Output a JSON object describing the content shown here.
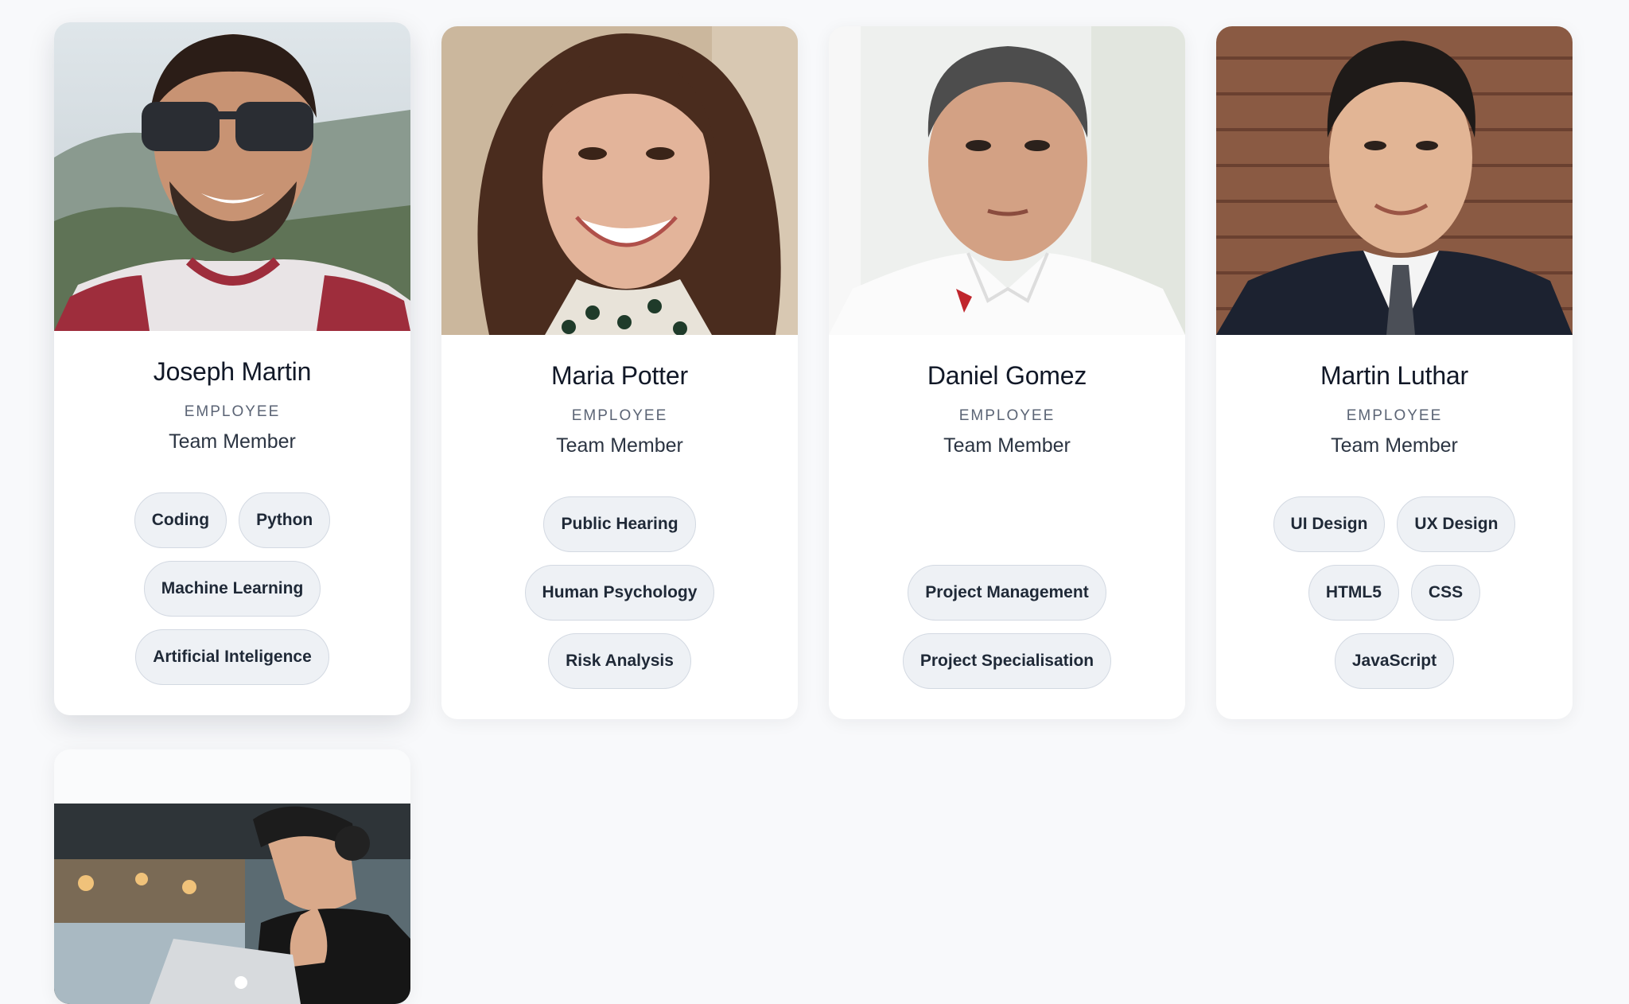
{
  "cards": [
    {
      "name": "Joseph Martin",
      "role": "EMPLOYEE",
      "title": "Team Member",
      "photo": "portrait-man-sunglasses",
      "tag_rows": [
        [
          "Coding",
          "Python"
        ],
        [
          "Machine Learning"
        ],
        [
          "Artificial Inteligence"
        ]
      ]
    },
    {
      "name": "Maria Potter",
      "role": "EMPLOYEE",
      "title": "Team Member",
      "photo": "portrait-woman-smiling",
      "tag_rows": [
        [
          "Public Hearing"
        ],
        [
          "Human Psychology"
        ],
        [
          "Risk Analysis"
        ]
      ]
    },
    {
      "name": "Daniel Gomez",
      "role": "EMPLOYEE",
      "title": "Team Member",
      "photo": "portrait-man-white-polo",
      "tag_rows": [
        [],
        [
          "Project Management"
        ],
        [
          "Project Specialisation"
        ]
      ]
    },
    {
      "name": "Martin Luthar",
      "role": "EMPLOYEE",
      "title": "Team Member",
      "photo": "portrait-man-suit",
      "tag_rows": [
        [
          "UI Design",
          "UX Design"
        ],
        [
          "HTML5",
          "CSS"
        ],
        [
          "JavaScript"
        ]
      ]
    },
    {
      "photo": "photo-man-headphones-laptop"
    }
  ],
  "colors": {
    "page_background": "#f8f9fb",
    "card_background": "#ffffff",
    "tag_background": "#eef1f5",
    "tag_border": "#d3d9e2",
    "role_text": "#5b6475"
  }
}
